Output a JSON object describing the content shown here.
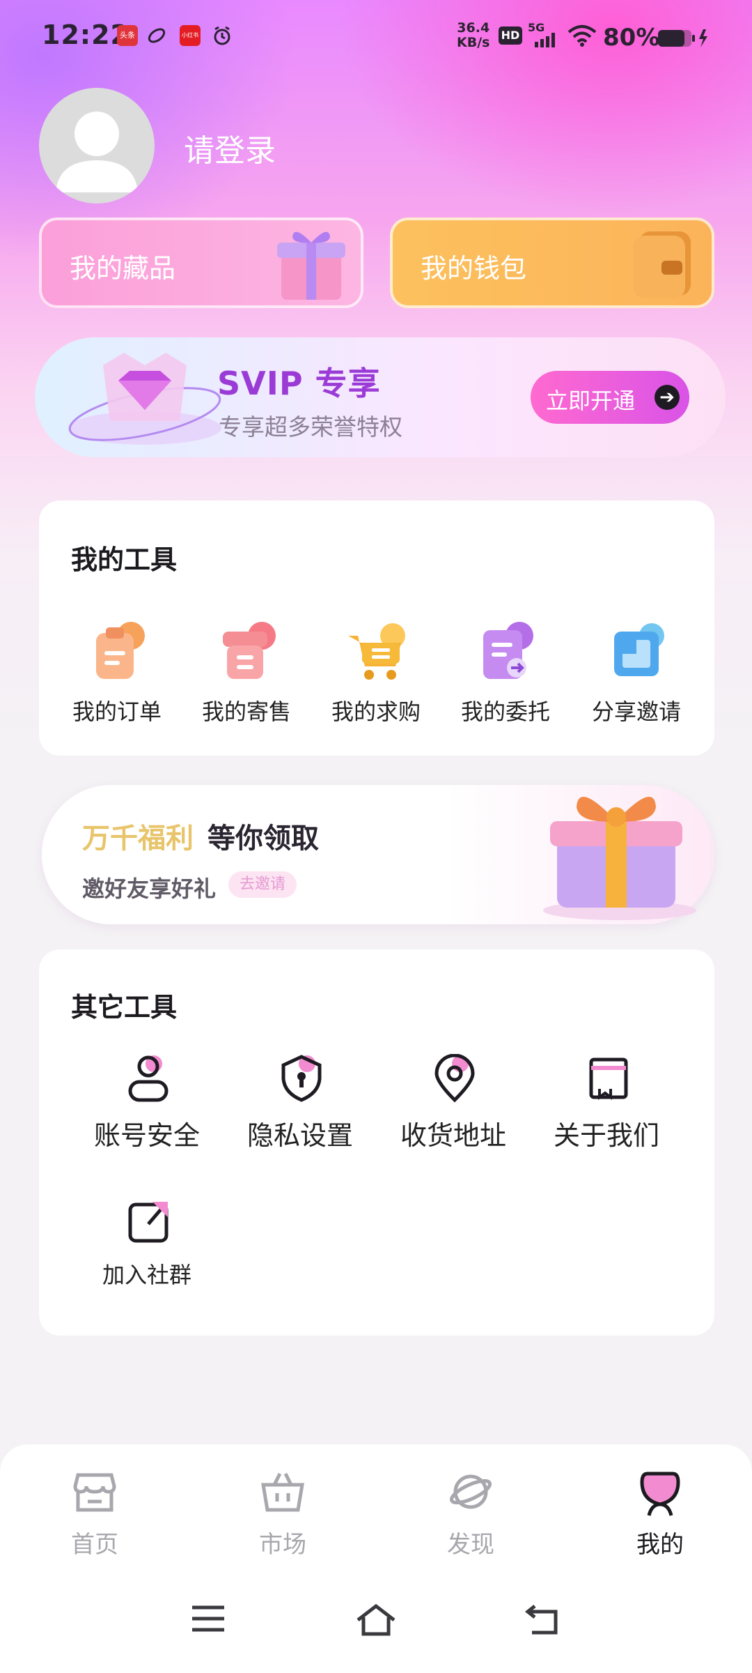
{
  "status_bar": {
    "time": "12:22",
    "net_speed_value": "36.4",
    "net_speed_unit": "KB/s",
    "hd_badge": "HD",
    "network": "5G",
    "battery_percent": "80%",
    "app_badge_1": "头条",
    "app_badge_2": "小红书"
  },
  "profile": {
    "login_prompt": "请登录"
  },
  "quick_cards": {
    "collection": "我的藏品",
    "wallet": "我的钱包"
  },
  "svip": {
    "title": "SVIP 专享",
    "subtitle": "专享超多荣誉特权",
    "button": "立即开通",
    "accent": "#9b3bd6"
  },
  "my_tools": {
    "title": "我的工具",
    "items": [
      {
        "label": "我的订单",
        "icon": "order-clipboard-icon"
      },
      {
        "label": "我的寄售",
        "icon": "consignment-box-icon"
      },
      {
        "label": "我的求购",
        "icon": "shopping-cart-icon"
      },
      {
        "label": "我的委托",
        "icon": "entrust-document-icon"
      },
      {
        "label": "分享邀请",
        "icon": "share-invite-icon"
      }
    ]
  },
  "welfare_banner": {
    "title_highlight": "万千福利",
    "title_rest": "等你领取",
    "subtitle": "邀好友享好礼",
    "pill": "去邀请"
  },
  "other_tools": {
    "title": "其它工具",
    "items": [
      {
        "label": "账号安全",
        "icon": "user-account-icon"
      },
      {
        "label": "隐私设置",
        "icon": "privacy-shield-icon"
      },
      {
        "label": "收货地址",
        "icon": "location-pin-icon"
      },
      {
        "label": "关于我们",
        "icon": "about-book-icon"
      },
      {
        "label": "加入社群",
        "icon": "external-link-icon"
      }
    ]
  },
  "bottom_nav": {
    "items": [
      {
        "label": "首页",
        "icon": "storefront-icon"
      },
      {
        "label": "市场",
        "icon": "basket-icon"
      },
      {
        "label": "发现",
        "icon": "planet-icon"
      },
      {
        "label": "我的",
        "icon": "profile-icon"
      }
    ],
    "active": "我的"
  }
}
